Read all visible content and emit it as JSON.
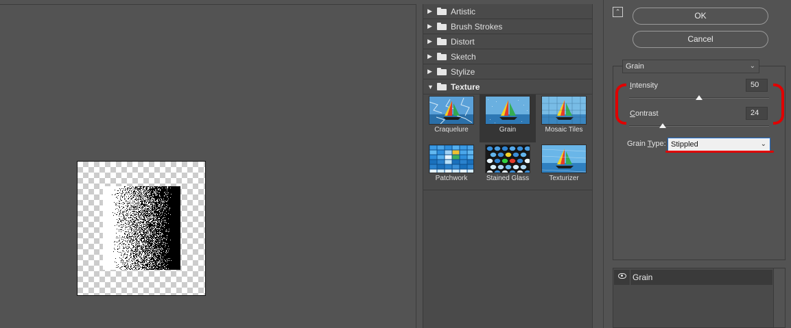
{
  "dialog": {
    "ok_label": "OK",
    "cancel_label": "Cancel"
  },
  "gallery": {
    "categories": [
      {
        "label": "Artistic",
        "expanded": false
      },
      {
        "label": "Brush Strokes",
        "expanded": false
      },
      {
        "label": "Distort",
        "expanded": false
      },
      {
        "label": "Sketch",
        "expanded": false
      },
      {
        "label": "Stylize",
        "expanded": false
      },
      {
        "label": "Texture",
        "expanded": true
      }
    ],
    "texture_filters": [
      {
        "label": "Craquelure",
        "selected": false
      },
      {
        "label": "Grain",
        "selected": true
      },
      {
        "label": "Mosaic Tiles",
        "selected": false
      },
      {
        "label": "Patchwork",
        "selected": false
      },
      {
        "label": "Stained Glass",
        "selected": false
      },
      {
        "label": "Texturizer",
        "selected": false
      }
    ]
  },
  "settings": {
    "filter": "Grain",
    "intensity_label_first": "I",
    "intensity_label_rest": "ntensity",
    "intensity_value": "50",
    "intensity_fraction": 0.5,
    "contrast_label_first": "C",
    "contrast_label_rest": "ontrast",
    "contrast_value": "24",
    "contrast_fraction": 0.24,
    "grain_type_label_pre": "Grain ",
    "grain_type_label_u": "T",
    "grain_type_label_post": "ype:",
    "grain_type": "Stippled"
  },
  "layers": {
    "items": [
      {
        "label": "Grain",
        "visible": true
      }
    ]
  },
  "colors": {
    "background": "#535353",
    "annotation_red": "#e00000",
    "select_highlight": "#1e6fd0"
  },
  "icons": {
    "collapse": "double-chevron-up-icon",
    "category_arrow": "triangle-right-icon",
    "folder": "folder-icon",
    "eye": "eye-icon"
  }
}
